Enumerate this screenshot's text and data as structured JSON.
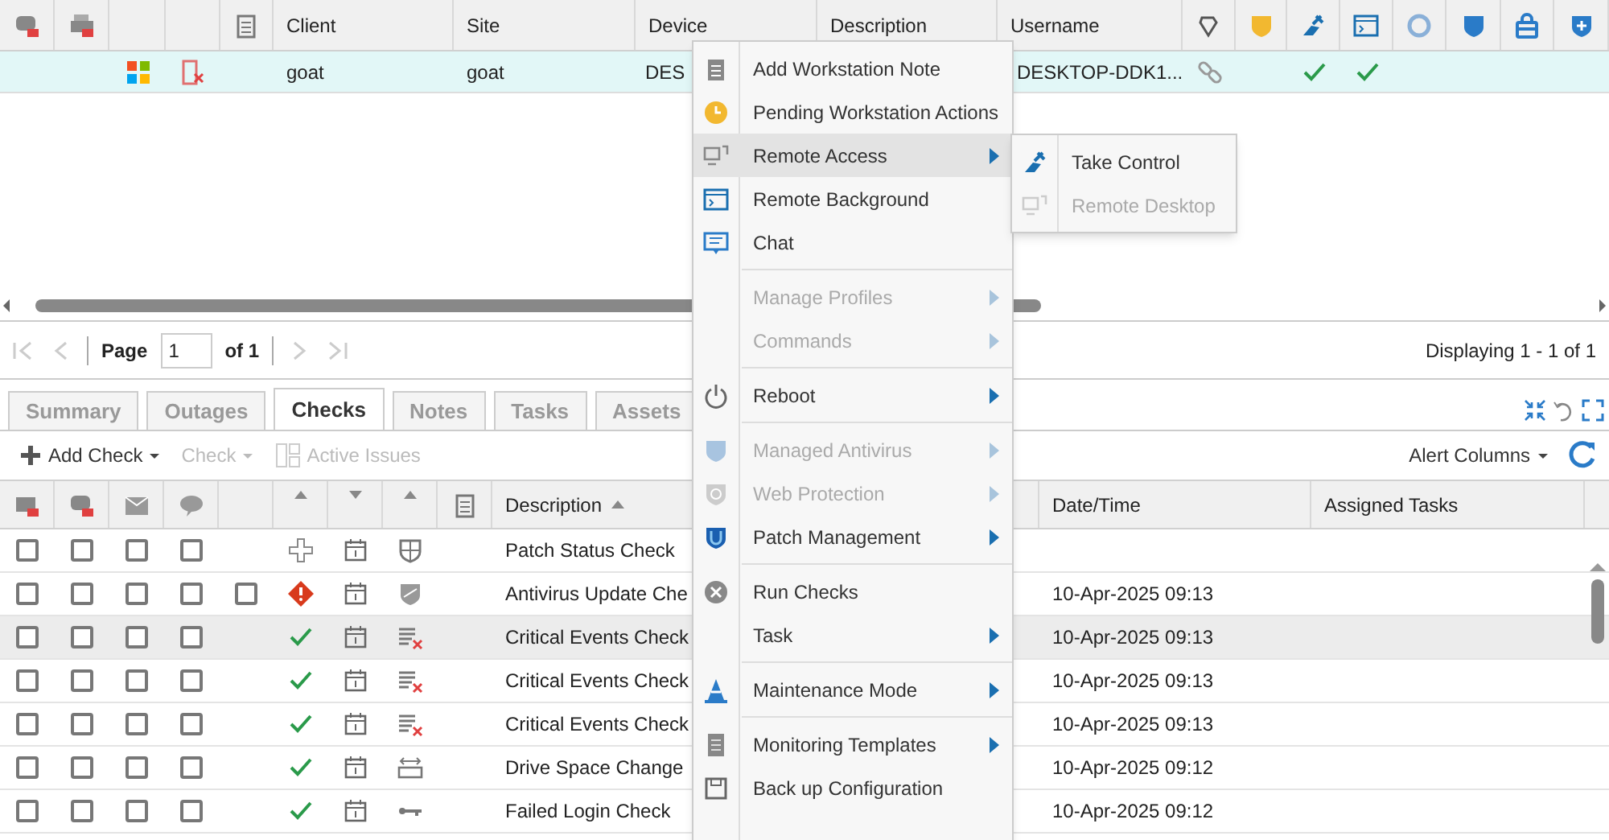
{
  "devices": {
    "columns": [
      {
        "label": "Client"
      },
      {
        "label": "Site"
      },
      {
        "label": "Device"
      },
      {
        "label": "Description"
      },
      {
        "label": "Username"
      }
    ],
    "rows": [
      {
        "selected": true,
        "client": "goat",
        "site": "goat",
        "device": "DES",
        "username": "DESKTOP-DDK1...",
        "features": [
          {
            "on": false
          },
          {
            "on": true
          },
          {
            "on": true
          },
          {
            "on": false
          },
          {
            "on": false
          },
          {
            "on": false
          },
          {
            "on": false
          }
        ]
      }
    ],
    "pager": {
      "page_label": "Page",
      "page": "1",
      "of": "of 1",
      "displaying": "Displaying 1 - 1 of 1"
    }
  },
  "detail": {
    "tabs": [
      {
        "label": "Summary",
        "selected": false
      },
      {
        "label": "Outages",
        "selected": false
      },
      {
        "label": "Checks",
        "selected": true
      },
      {
        "label": "Notes",
        "selected": false
      },
      {
        "label": "Tasks",
        "selected": false
      },
      {
        "label": "Assets",
        "selected": false
      }
    ],
    "toolbar": [
      {
        "label": "Add Check",
        "disabled": false,
        "dropdown": true
      },
      {
        "label": "Check",
        "disabled": true,
        "dropdown": true
      },
      {
        "label": "Active Issues",
        "disabled": true,
        "dropdown": false
      }
    ],
    "alert_columns": "Alert Columns",
    "columns": [
      {
        "label": "Description",
        "sorted": true
      },
      {
        "label": "Date/Time",
        "sorted": false
      },
      {
        "label": "Assigned Tasks",
        "sorted": false
      }
    ],
    "rows": [
      {
        "selected": false,
        "status_icon": {
          "kind": "pending"
        },
        "type_icon": {
          "kind": "patch"
        },
        "description": "Patch Status Check",
        "datetime": "",
        "flags": [
          {
            "checked": false
          },
          {
            "checked": false
          },
          {
            "checked": false
          },
          {
            "checked": false
          }
        ]
      },
      {
        "selected": false,
        "status_icon": {
          "kind": "failed"
        },
        "type_icon": {
          "kind": "antivirus"
        },
        "description": "Antivirus Update Che",
        "datetime": "10-Apr-2025 09:13",
        "flags": [
          {
            "checked": false
          },
          {
            "checked": false
          },
          {
            "checked": false
          },
          {
            "checked": false
          },
          {
            "checked": false
          }
        ]
      },
      {
        "selected": true,
        "status_icon": {
          "kind": "passed"
        },
        "type_icon": {
          "kind": "events"
        },
        "description": "Critical Events Check",
        "datetime": "10-Apr-2025 09:13",
        "flags": [
          {
            "checked": false
          },
          {
            "checked": false
          },
          {
            "checked": false
          },
          {
            "checked": false
          }
        ]
      },
      {
        "selected": false,
        "status_icon": {
          "kind": "passed"
        },
        "type_icon": {
          "kind": "events"
        },
        "description": "Critical Events Check",
        "datetime": "10-Apr-2025 09:13",
        "flags": [
          {
            "checked": false
          },
          {
            "checked": false
          },
          {
            "checked": false
          },
          {
            "checked": false
          }
        ]
      },
      {
        "selected": false,
        "status_icon": {
          "kind": "passed"
        },
        "type_icon": {
          "kind": "events"
        },
        "description": "Critical Events Check",
        "datetime": "10-Apr-2025 09:13",
        "flags": [
          {
            "checked": false
          },
          {
            "checked": false
          },
          {
            "checked": false
          },
          {
            "checked": false
          }
        ]
      },
      {
        "selected": false,
        "status_icon": {
          "kind": "passed"
        },
        "type_icon": {
          "kind": "disk"
        },
        "description": "Drive Space Change",
        "datetime": "10-Apr-2025 09:12",
        "flags": [
          {
            "checked": false
          },
          {
            "checked": false
          },
          {
            "checked": false
          },
          {
            "checked": false
          }
        ]
      },
      {
        "selected": false,
        "status_icon": {
          "kind": "passed"
        },
        "type_icon": {
          "kind": "login"
        },
        "description": "Failed Login Check",
        "datetime": "10-Apr-2025 09:12",
        "flags": [
          {
            "checked": false
          },
          {
            "checked": false
          },
          {
            "checked": false
          },
          {
            "checked": false
          }
        ]
      }
    ]
  },
  "context_menu": {
    "items": [
      {
        "kind": "item",
        "label": "Add Workstation Note",
        "disabled": false,
        "submenu": false,
        "selected": false
      },
      {
        "kind": "item",
        "label": "Pending Workstation Actions",
        "disabled": false,
        "submenu": false,
        "selected": false
      },
      {
        "kind": "item",
        "label": "Remote Access",
        "disabled": false,
        "submenu": true,
        "selected": true
      },
      {
        "kind": "item",
        "label": "Remote Background",
        "disabled": false,
        "submenu": false,
        "selected": false
      },
      {
        "kind": "item",
        "label": "Chat",
        "disabled": false,
        "submenu": false,
        "selected": false
      },
      {
        "kind": "separator"
      },
      {
        "kind": "item",
        "label": "Manage Profiles",
        "disabled": true,
        "submenu": true,
        "selected": false
      },
      {
        "kind": "item",
        "label": "Commands",
        "disabled": true,
        "submenu": true,
        "selected": false
      },
      {
        "kind": "separator"
      },
      {
        "kind": "item",
        "label": "Reboot",
        "disabled": false,
        "submenu": true,
        "selected": false
      },
      {
        "kind": "separator"
      },
      {
        "kind": "item",
        "label": "Managed Antivirus",
        "disabled": true,
        "submenu": true,
        "selected": false
      },
      {
        "kind": "item",
        "label": "Web Protection",
        "disabled": true,
        "submenu": true,
        "selected": false
      },
      {
        "kind": "item",
        "label": "Patch Management",
        "disabled": false,
        "submenu": true,
        "selected": false
      },
      {
        "kind": "separator"
      },
      {
        "kind": "item",
        "label": "Run Checks",
        "disabled": false,
        "submenu": false,
        "selected": false
      },
      {
        "kind": "item",
        "label": "Task",
        "disabled": false,
        "submenu": true,
        "selected": false
      },
      {
        "kind": "separator"
      },
      {
        "kind": "item",
        "label": "Maintenance Mode",
        "disabled": false,
        "submenu": true,
        "selected": false
      },
      {
        "kind": "separator"
      },
      {
        "kind": "item",
        "label": "Monitoring Templates",
        "disabled": false,
        "submenu": true,
        "selected": false
      },
      {
        "kind": "item",
        "label": "Back up Configuration",
        "disabled": false,
        "submenu": false,
        "selected": false
      }
    ]
  },
  "submenu": {
    "items": [
      {
        "label": "Take Control",
        "disabled": false
      },
      {
        "label": "Remote Desktop",
        "disabled": true
      }
    ]
  }
}
